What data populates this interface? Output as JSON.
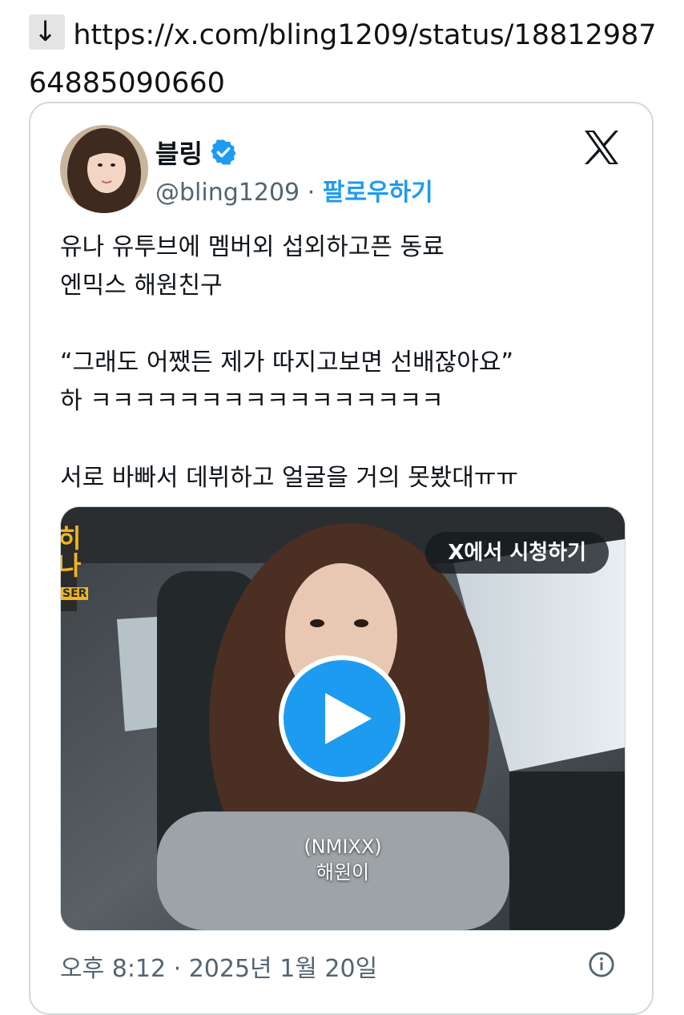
{
  "link": {
    "arrow": "↓",
    "url": "https://x.com/bling1209/status/1881298764885090660"
  },
  "tweet": {
    "display_name": "블링",
    "verified": true,
    "handle": "@bling1209",
    "separator": "·",
    "follow_label": "팔로우하기",
    "text": "유나 유투브에 멤버외 섭외하고픈 동료\n엔믹스 해원친구\n\n“그래도 어쨌든 제가 따지고보면 선배잖아요”\n하 ㅋㅋㅋㅋㅋㅋㅋㅋㅋㅋㅋㅋㅋㅋㅋㅋ\n\n서로 바빠서 데뷔하고 얼굴을 거의 못봤대ㅠㅠ",
    "timestamp": "오후 8:12 · 2025년 1월 20일"
  },
  "video": {
    "watch_on_x_label": "X에서 시청하기",
    "caption_line1": "(NMIXX)",
    "caption_line2": "해원이",
    "corner_title_chars": "히\n나",
    "corner_tag": "SER"
  },
  "icons": {
    "x_logo": "x-logo-icon",
    "verified_badge": "verified-badge-icon",
    "play": "play-icon",
    "info": "info-icon"
  },
  "colors": {
    "accent": "#1d9bf0",
    "text": "#0f1419",
    "muted": "#536471",
    "border": "#cfd9de"
  }
}
